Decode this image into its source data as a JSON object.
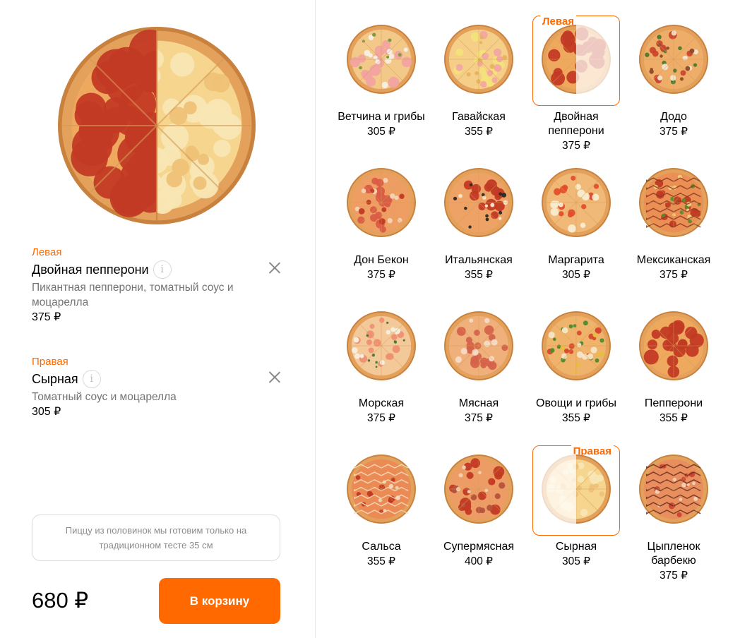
{
  "summary": {
    "left": {
      "side_label": "Левая",
      "title": "Двойная пепперони",
      "description": "Пикантная пепперони, томатный соус и моцарелла",
      "price": "375 ₽"
    },
    "right": {
      "side_label": "Правая",
      "title": "Сырная",
      "description": "Томатный соус и моцарелла",
      "price": "305 ₽"
    },
    "info_icon": "info-icon",
    "close_icon": "close-icon",
    "note": "Пиццу из половинок мы готовим только на традиционном тесте 35 см",
    "total": "680 ₽",
    "cart_button": "В корзину"
  },
  "pizzas": [
    {
      "name": "Ветчина и грибы",
      "price": "305 ₽",
      "style": "ham"
    },
    {
      "name": "Гавайская",
      "price": "355 ₽",
      "style": "hawaiian"
    },
    {
      "name": "Двойная пепперони",
      "price": "375 ₽",
      "style": "pepperoni",
      "selected": "Левая"
    },
    {
      "name": "Додо",
      "price": "375 ₽",
      "style": "mixed"
    },
    {
      "name": "Дон Бекон",
      "price": "375 ₽",
      "style": "bacon"
    },
    {
      "name": "Итальянская",
      "price": "355 ₽",
      "style": "italian"
    },
    {
      "name": "Маргарита",
      "price": "305 ₽",
      "style": "margherita"
    },
    {
      "name": "Мексиканская",
      "price": "375 ₽",
      "style": "mexican"
    },
    {
      "name": "Морская",
      "price": "375 ₽",
      "style": "sea"
    },
    {
      "name": "Мясная",
      "price": "375 ₽",
      "style": "meat"
    },
    {
      "name": "Овощи и грибы",
      "price": "355 ₽",
      "style": "veggie"
    },
    {
      "name": "Пепперони",
      "price": "355 ₽",
      "style": "pepperoni"
    },
    {
      "name": "Сальса",
      "price": "355 ₽",
      "style": "salsa"
    },
    {
      "name": "Супермясная",
      "price": "400 ₽",
      "style": "supermeat"
    },
    {
      "name": "Сырная",
      "price": "305 ₽",
      "style": "cheese",
      "selected": "Правая"
    },
    {
      "name": "Цыпленок барбекю",
      "price": "375 ₽",
      "style": "bbq"
    }
  ],
  "colors": {
    "accent": "#ff6900",
    "crust": "#e3a15c",
    "crust_dark": "#c9813e",
    "cheese": "#f7d89a",
    "sauce": "#e8613a",
    "pepperoni": "#c23a24",
    "muted_text": "#737373"
  }
}
